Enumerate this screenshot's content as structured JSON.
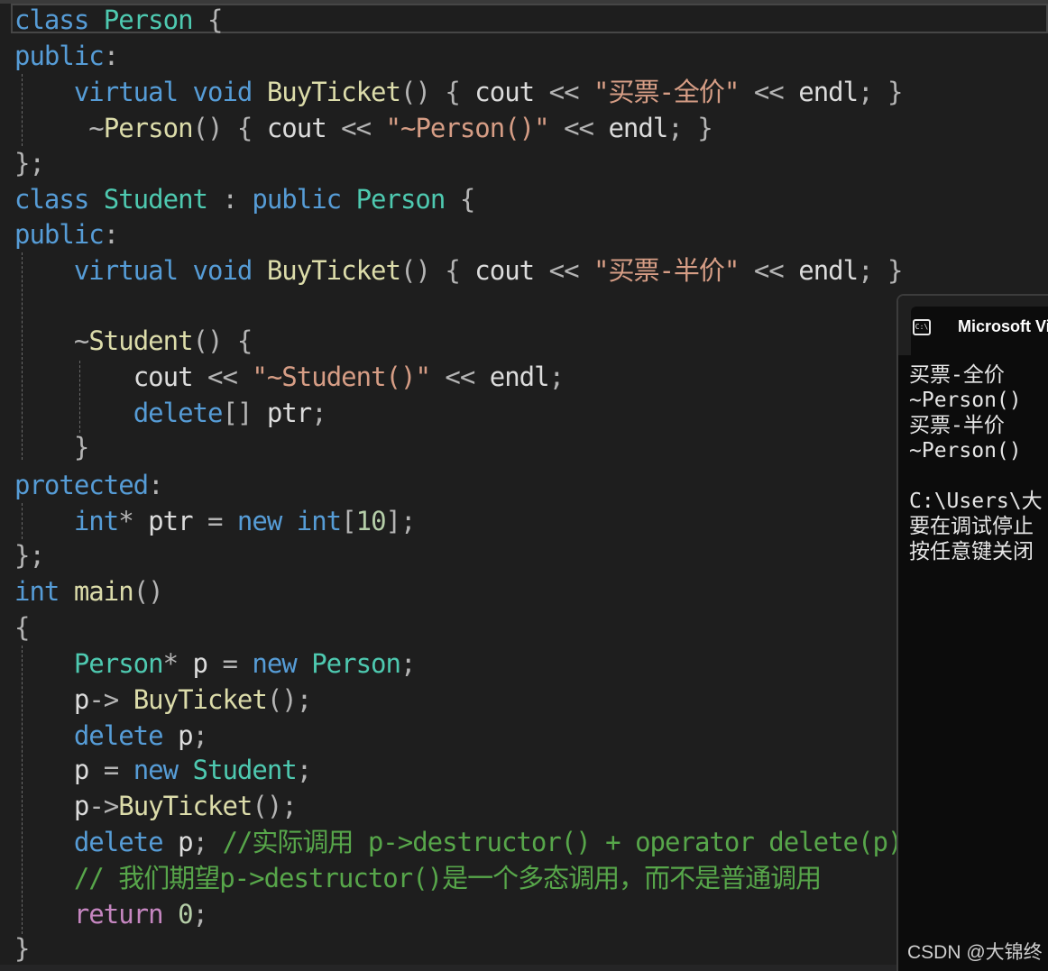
{
  "editor": {
    "lines": [
      {
        "id": "l0",
        "tokens": [
          [
            "kw",
            "class "
          ],
          [
            "ty",
            "Person"
          ],
          [
            "op",
            " {"
          ]
        ]
      },
      {
        "id": "l1",
        "tokens": [
          [
            "kw",
            "public"
          ],
          [
            "op",
            ":"
          ]
        ]
      },
      {
        "id": "l2",
        "tokens": [
          [
            "op",
            "    "
          ],
          [
            "kw",
            "virtual "
          ],
          [
            "kw",
            "void "
          ],
          [
            "fn",
            "BuyTicket"
          ],
          [
            "op",
            "() { "
          ],
          [
            "id",
            "cout "
          ],
          [
            "op",
            "<< "
          ],
          [
            "st",
            "\"买票-全价\""
          ],
          [
            "op",
            " << "
          ],
          [
            "id",
            "endl"
          ],
          [
            "op",
            "; }"
          ]
        ]
      },
      {
        "id": "l3",
        "tokens": [
          [
            "op",
            "     ~"
          ],
          [
            "fn",
            "Person"
          ],
          [
            "op",
            "() { "
          ],
          [
            "id",
            "cout "
          ],
          [
            "op",
            "<< "
          ],
          [
            "st",
            "\"~Person()\""
          ],
          [
            "op",
            " << "
          ],
          [
            "id",
            "endl"
          ],
          [
            "op",
            "; }"
          ]
        ]
      },
      {
        "id": "l4",
        "tokens": [
          [
            "op",
            "};"
          ]
        ]
      },
      {
        "id": "l5",
        "tokens": [
          [
            "kw",
            "class "
          ],
          [
            "ty",
            "Student"
          ],
          [
            "op",
            " : "
          ],
          [
            "kw",
            "public "
          ],
          [
            "ty",
            "Person"
          ],
          [
            "op",
            " {"
          ]
        ]
      },
      {
        "id": "l6",
        "tokens": [
          [
            "kw",
            "public"
          ],
          [
            "op",
            ":"
          ]
        ]
      },
      {
        "id": "l7",
        "tokens": [
          [
            "op",
            "    "
          ],
          [
            "kw",
            "virtual "
          ],
          [
            "kw",
            "void "
          ],
          [
            "fn",
            "BuyTicket"
          ],
          [
            "op",
            "() { "
          ],
          [
            "id",
            "cout "
          ],
          [
            "op",
            "<< "
          ],
          [
            "st",
            "\"买票-半价\""
          ],
          [
            "op",
            " << "
          ],
          [
            "id",
            "endl"
          ],
          [
            "op",
            "; }"
          ]
        ]
      },
      {
        "id": "l8",
        "tokens": [
          [
            "op",
            ""
          ]
        ]
      },
      {
        "id": "l9",
        "tokens": [
          [
            "op",
            "    ~"
          ],
          [
            "fn",
            "Student"
          ],
          [
            "op",
            "() {"
          ]
        ]
      },
      {
        "id": "l10",
        "tokens": [
          [
            "op",
            "        "
          ],
          [
            "id",
            "cout "
          ],
          [
            "op",
            "<< "
          ],
          [
            "st",
            "\"~Student()\""
          ],
          [
            "op",
            " << "
          ],
          [
            "id",
            "endl"
          ],
          [
            "op",
            ";"
          ]
        ]
      },
      {
        "id": "l11",
        "tokens": [
          [
            "op",
            "        "
          ],
          [
            "kw",
            "delete"
          ],
          [
            "op",
            "[] "
          ],
          [
            "id",
            "ptr"
          ],
          [
            "op",
            ";"
          ]
        ]
      },
      {
        "id": "l12",
        "tokens": [
          [
            "op",
            "    }"
          ]
        ]
      },
      {
        "id": "l13",
        "tokens": [
          [
            "kw",
            "protected"
          ],
          [
            "op",
            ":"
          ]
        ]
      },
      {
        "id": "l14",
        "tokens": [
          [
            "op",
            "    "
          ],
          [
            "kw",
            "int"
          ],
          [
            "op",
            "* "
          ],
          [
            "id",
            "ptr "
          ],
          [
            "op",
            "= "
          ],
          [
            "kw",
            "new "
          ],
          [
            "kw",
            "int"
          ],
          [
            "op",
            "["
          ],
          [
            "nm",
            "10"
          ],
          [
            "op",
            "];"
          ]
        ]
      },
      {
        "id": "l15",
        "tokens": [
          [
            "op",
            "};"
          ]
        ]
      },
      {
        "id": "l16",
        "tokens": [
          [
            "kw",
            "int "
          ],
          [
            "fn",
            "main"
          ],
          [
            "op",
            "()"
          ]
        ]
      },
      {
        "id": "l17",
        "tokens": [
          [
            "op",
            "{"
          ]
        ]
      },
      {
        "id": "l18",
        "tokens": [
          [
            "op",
            "    "
          ],
          [
            "ty",
            "Person"
          ],
          [
            "op",
            "* "
          ],
          [
            "id",
            "p "
          ],
          [
            "op",
            "= "
          ],
          [
            "kw",
            "new "
          ],
          [
            "ty",
            "Person"
          ],
          [
            "op",
            ";"
          ]
        ]
      },
      {
        "id": "l19",
        "tokens": [
          [
            "op",
            "    "
          ],
          [
            "id",
            "p"
          ],
          [
            "op",
            "-> "
          ],
          [
            "fn",
            "BuyTicket"
          ],
          [
            "op",
            "();"
          ]
        ]
      },
      {
        "id": "l20",
        "tokens": [
          [
            "op",
            "    "
          ],
          [
            "kw",
            "delete "
          ],
          [
            "id",
            "p"
          ],
          [
            "op",
            ";"
          ]
        ]
      },
      {
        "id": "l21",
        "tokens": [
          [
            "op",
            "    "
          ],
          [
            "id",
            "p "
          ],
          [
            "op",
            "= "
          ],
          [
            "kw",
            "new "
          ],
          [
            "ty",
            "Student"
          ],
          [
            "op",
            ";"
          ]
        ]
      },
      {
        "id": "l22",
        "tokens": [
          [
            "op",
            "    "
          ],
          [
            "id",
            "p"
          ],
          [
            "op",
            "->"
          ],
          [
            "fn",
            "BuyTicket"
          ],
          [
            "op",
            "();"
          ]
        ]
      },
      {
        "id": "l23",
        "tokens": [
          [
            "op",
            "    "
          ],
          [
            "kw",
            "delete "
          ],
          [
            "id",
            "p"
          ],
          [
            "op",
            "; "
          ],
          [
            "cm",
            "//实际调用 p->destructor() + operator delete(p)"
          ]
        ]
      },
      {
        "id": "l24",
        "tokens": [
          [
            "op",
            "    "
          ],
          [
            "cm",
            "// 我们期望p->destructor()是一个多态调用，而不是普通调用"
          ]
        ]
      },
      {
        "id": "l25",
        "tokens": [
          [
            "op",
            "    "
          ],
          [
            "pp",
            "return "
          ],
          [
            "nm",
            "0"
          ],
          [
            "op",
            ";"
          ]
        ]
      },
      {
        "id": "l26",
        "tokens": [
          [
            "op",
            "}"
          ]
        ]
      }
    ]
  },
  "console": {
    "title": "Microsoft Vi",
    "icon": "terminal-icon",
    "output_lines": [
      "买票-全价",
      "~Person()",
      "买票-半价",
      "~Person()",
      "",
      "C:\\Users\\大",
      "要在调试停止",
      "按任意键关闭"
    ]
  },
  "watermark": "CSDN @大锦终",
  "colors": {
    "background": "#1e1e1e",
    "keyword": "#569cd6",
    "type": "#4ec9b0",
    "function": "#dcdcaa",
    "string": "#d69d85",
    "comment": "#57a64a",
    "control": "#c586c0"
  }
}
